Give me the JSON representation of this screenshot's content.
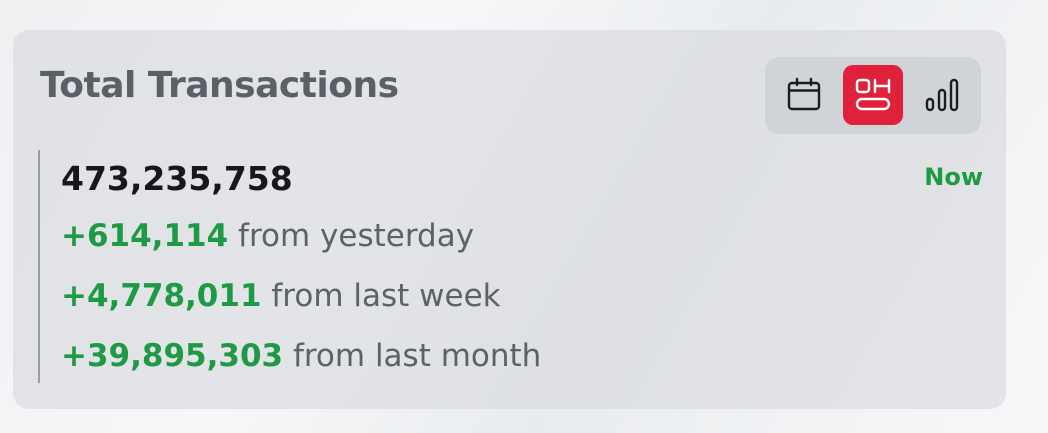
{
  "card": {
    "title": "Total Transactions",
    "total": "473,235,758",
    "period_label": "Now",
    "view_toggle": [
      {
        "icon": "calendar-icon",
        "active": false
      },
      {
        "icon": "timeline-icon",
        "active": true
      },
      {
        "icon": "bar-chart-icon",
        "active": false
      }
    ],
    "changes": [
      {
        "delta": "+614,114",
        "label": "from yesterday"
      },
      {
        "delta": "+4,778,011",
        "label": "from last week"
      },
      {
        "delta": "+39,895,303",
        "label": "from last month"
      }
    ]
  },
  "colors": {
    "accent_active": "#e0213c",
    "positive": "#1e9a45",
    "title": "#5b5f66"
  }
}
